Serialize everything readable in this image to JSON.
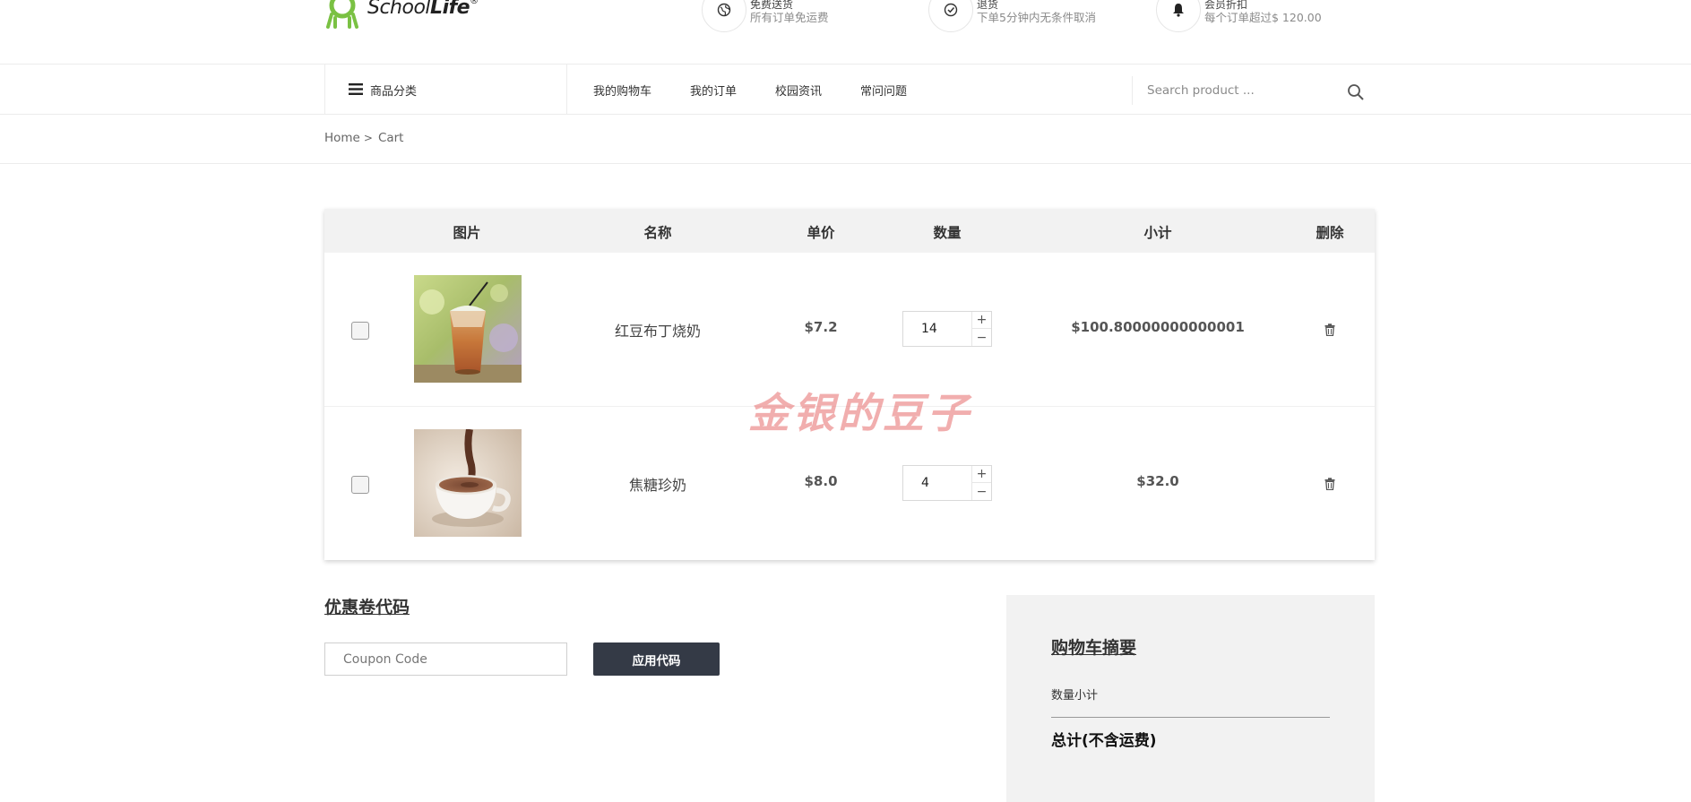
{
  "brand": {
    "name_part1": "School",
    "name_part2": "Life",
    "trademark": "®",
    "accent": "#7ac143"
  },
  "header_info": [
    {
      "icon": "globe-icon",
      "title": "免费送货",
      "subtitle": "所有订单免运费"
    },
    {
      "icon": "check-circle-icon",
      "title": "退货",
      "subtitle": "下单5分钟内无条件取消"
    },
    {
      "icon": "bell-icon",
      "title": "会员折扣",
      "subtitle": "每个订单超过$ 120.00"
    }
  ],
  "nav": {
    "category_label": "商品分类",
    "menu": [
      "我的购物车",
      "我的订单",
      "校园资讯",
      "常问问题"
    ],
    "search_placeholder": "Search product ..."
  },
  "breadcrumb": {
    "home": "Home",
    "separator": ">",
    "current": "Cart"
  },
  "cart": {
    "headers": {
      "image": "图片",
      "name": "名称",
      "price": "单价",
      "quantity": "数量",
      "subtotal": "小计",
      "delete": "删除"
    },
    "items": [
      {
        "name": "红豆布丁烧奶",
        "price": "$7.2",
        "quantity": "14",
        "subtotal": "$100.80000000000001",
        "checked": false
      },
      {
        "name": "焦糖珍奶",
        "price": "$8.0",
        "quantity": "4",
        "subtotal": "$32.0",
        "checked": false
      }
    ]
  },
  "watermark": "金银的豆子",
  "coupon": {
    "title": "优惠卷代码",
    "placeholder": "Coupon Code",
    "apply_label": "应用代码",
    "button_color": "#343a46"
  },
  "summary": {
    "title": "购物车摘要",
    "qty_subtotal_label": "数量小计",
    "total_label": "总计(不含运费)"
  }
}
